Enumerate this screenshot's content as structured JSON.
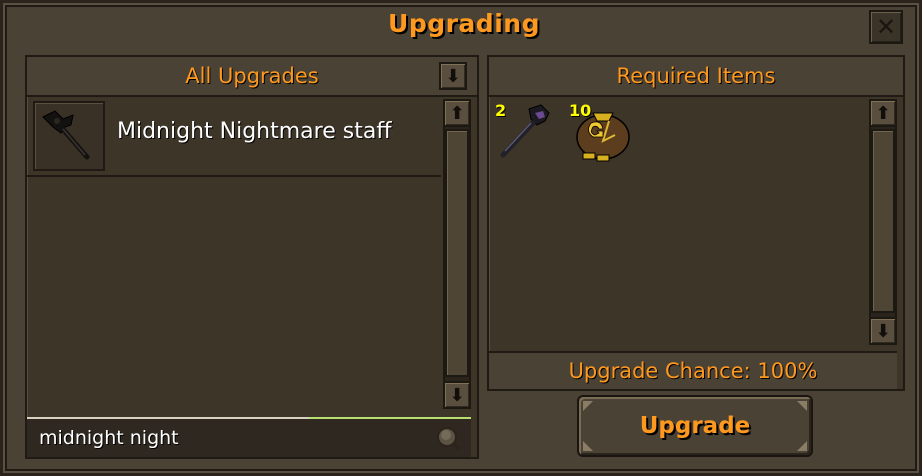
{
  "window": {
    "title": "Upgrading",
    "close_icon": "close-icon",
    "title_color": "#ff981f"
  },
  "upgrades_panel": {
    "header": "All Upgrades",
    "collapse_icon": "chevron-down-icon",
    "items": [
      {
        "label": "Midnight Nightmare staff",
        "icon": "staff-icon"
      }
    ],
    "search": {
      "value": "midnight night",
      "icon": "search-icon"
    }
  },
  "required_panel": {
    "header": "Required Items",
    "items": [
      {
        "quantity": "2",
        "icon": "staff-icon"
      },
      {
        "quantity": "10",
        "icon": "coin-pouch-icon"
      }
    ],
    "chance_label": "Upgrade Chance: 100%"
  },
  "upgrade_button": {
    "label": "Upgrade"
  }
}
